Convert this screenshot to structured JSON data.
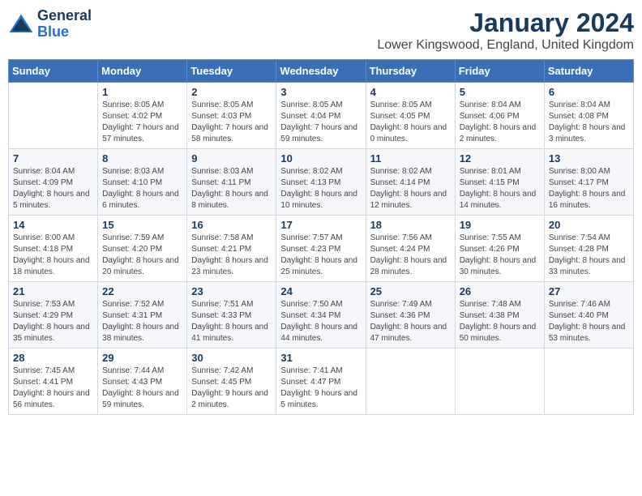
{
  "logo": {
    "line1": "General",
    "line2": "Blue"
  },
  "title": "January 2024",
  "location": "Lower Kingswood, England, United Kingdom",
  "weekdays": [
    "Sunday",
    "Monday",
    "Tuesday",
    "Wednesday",
    "Thursday",
    "Friday",
    "Saturday"
  ],
  "weeks": [
    [
      {
        "day": "",
        "sunrise": "",
        "sunset": "",
        "daylight": ""
      },
      {
        "day": "1",
        "sunrise": "Sunrise: 8:05 AM",
        "sunset": "Sunset: 4:02 PM",
        "daylight": "Daylight: 7 hours and 57 minutes."
      },
      {
        "day": "2",
        "sunrise": "Sunrise: 8:05 AM",
        "sunset": "Sunset: 4:03 PM",
        "daylight": "Daylight: 7 hours and 58 minutes."
      },
      {
        "day": "3",
        "sunrise": "Sunrise: 8:05 AM",
        "sunset": "Sunset: 4:04 PM",
        "daylight": "Daylight: 7 hours and 59 minutes."
      },
      {
        "day": "4",
        "sunrise": "Sunrise: 8:05 AM",
        "sunset": "Sunset: 4:05 PM",
        "daylight": "Daylight: 8 hours and 0 minutes."
      },
      {
        "day": "5",
        "sunrise": "Sunrise: 8:04 AM",
        "sunset": "Sunset: 4:06 PM",
        "daylight": "Daylight: 8 hours and 2 minutes."
      },
      {
        "day": "6",
        "sunrise": "Sunrise: 8:04 AM",
        "sunset": "Sunset: 4:08 PM",
        "daylight": "Daylight: 8 hours and 3 minutes."
      }
    ],
    [
      {
        "day": "7",
        "sunrise": "Sunrise: 8:04 AM",
        "sunset": "Sunset: 4:09 PM",
        "daylight": "Daylight: 8 hours and 5 minutes."
      },
      {
        "day": "8",
        "sunrise": "Sunrise: 8:03 AM",
        "sunset": "Sunset: 4:10 PM",
        "daylight": "Daylight: 8 hours and 6 minutes."
      },
      {
        "day": "9",
        "sunrise": "Sunrise: 8:03 AM",
        "sunset": "Sunset: 4:11 PM",
        "daylight": "Daylight: 8 hours and 8 minutes."
      },
      {
        "day": "10",
        "sunrise": "Sunrise: 8:02 AM",
        "sunset": "Sunset: 4:13 PM",
        "daylight": "Daylight: 8 hours and 10 minutes."
      },
      {
        "day": "11",
        "sunrise": "Sunrise: 8:02 AM",
        "sunset": "Sunset: 4:14 PM",
        "daylight": "Daylight: 8 hours and 12 minutes."
      },
      {
        "day": "12",
        "sunrise": "Sunrise: 8:01 AM",
        "sunset": "Sunset: 4:15 PM",
        "daylight": "Daylight: 8 hours and 14 minutes."
      },
      {
        "day": "13",
        "sunrise": "Sunrise: 8:00 AM",
        "sunset": "Sunset: 4:17 PM",
        "daylight": "Daylight: 8 hours and 16 minutes."
      }
    ],
    [
      {
        "day": "14",
        "sunrise": "Sunrise: 8:00 AM",
        "sunset": "Sunset: 4:18 PM",
        "daylight": "Daylight: 8 hours and 18 minutes."
      },
      {
        "day": "15",
        "sunrise": "Sunrise: 7:59 AM",
        "sunset": "Sunset: 4:20 PM",
        "daylight": "Daylight: 8 hours and 20 minutes."
      },
      {
        "day": "16",
        "sunrise": "Sunrise: 7:58 AM",
        "sunset": "Sunset: 4:21 PM",
        "daylight": "Daylight: 8 hours and 23 minutes."
      },
      {
        "day": "17",
        "sunrise": "Sunrise: 7:57 AM",
        "sunset": "Sunset: 4:23 PM",
        "daylight": "Daylight: 8 hours and 25 minutes."
      },
      {
        "day": "18",
        "sunrise": "Sunrise: 7:56 AM",
        "sunset": "Sunset: 4:24 PM",
        "daylight": "Daylight: 8 hours and 28 minutes."
      },
      {
        "day": "19",
        "sunrise": "Sunrise: 7:55 AM",
        "sunset": "Sunset: 4:26 PM",
        "daylight": "Daylight: 8 hours and 30 minutes."
      },
      {
        "day": "20",
        "sunrise": "Sunrise: 7:54 AM",
        "sunset": "Sunset: 4:28 PM",
        "daylight": "Daylight: 8 hours and 33 minutes."
      }
    ],
    [
      {
        "day": "21",
        "sunrise": "Sunrise: 7:53 AM",
        "sunset": "Sunset: 4:29 PM",
        "daylight": "Daylight: 8 hours and 35 minutes."
      },
      {
        "day": "22",
        "sunrise": "Sunrise: 7:52 AM",
        "sunset": "Sunset: 4:31 PM",
        "daylight": "Daylight: 8 hours and 38 minutes."
      },
      {
        "day": "23",
        "sunrise": "Sunrise: 7:51 AM",
        "sunset": "Sunset: 4:33 PM",
        "daylight": "Daylight: 8 hours and 41 minutes."
      },
      {
        "day": "24",
        "sunrise": "Sunrise: 7:50 AM",
        "sunset": "Sunset: 4:34 PM",
        "daylight": "Daylight: 8 hours and 44 minutes."
      },
      {
        "day": "25",
        "sunrise": "Sunrise: 7:49 AM",
        "sunset": "Sunset: 4:36 PM",
        "daylight": "Daylight: 8 hours and 47 minutes."
      },
      {
        "day": "26",
        "sunrise": "Sunrise: 7:48 AM",
        "sunset": "Sunset: 4:38 PM",
        "daylight": "Daylight: 8 hours and 50 minutes."
      },
      {
        "day": "27",
        "sunrise": "Sunrise: 7:46 AM",
        "sunset": "Sunset: 4:40 PM",
        "daylight": "Daylight: 8 hours and 53 minutes."
      }
    ],
    [
      {
        "day": "28",
        "sunrise": "Sunrise: 7:45 AM",
        "sunset": "Sunset: 4:41 PM",
        "daylight": "Daylight: 8 hours and 56 minutes."
      },
      {
        "day": "29",
        "sunrise": "Sunrise: 7:44 AM",
        "sunset": "Sunset: 4:43 PM",
        "daylight": "Daylight: 8 hours and 59 minutes."
      },
      {
        "day": "30",
        "sunrise": "Sunrise: 7:42 AM",
        "sunset": "Sunset: 4:45 PM",
        "daylight": "Daylight: 9 hours and 2 minutes."
      },
      {
        "day": "31",
        "sunrise": "Sunrise: 7:41 AM",
        "sunset": "Sunset: 4:47 PM",
        "daylight": "Daylight: 9 hours and 5 minutes."
      },
      {
        "day": "",
        "sunrise": "",
        "sunset": "",
        "daylight": ""
      },
      {
        "day": "",
        "sunrise": "",
        "sunset": "",
        "daylight": ""
      },
      {
        "day": "",
        "sunrise": "",
        "sunset": "",
        "daylight": ""
      }
    ]
  ]
}
